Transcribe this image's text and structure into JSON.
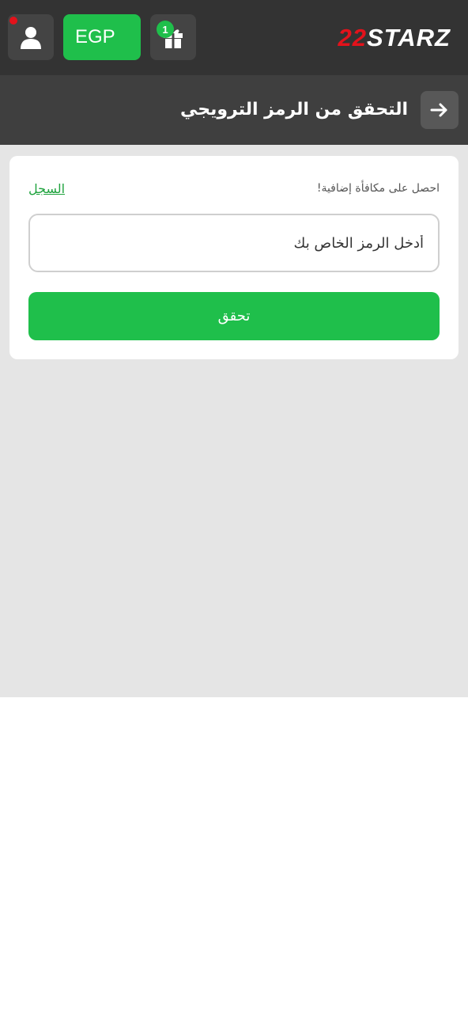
{
  "header": {
    "currency": "EGP",
    "gift_badge_count": "1",
    "logo_number": "22",
    "logo_word": "STARZ",
    "icons": {
      "user": "user-icon",
      "gift": "gift-icon",
      "back": "arrow-right-icon"
    },
    "colors": {
      "topbar": "#333333",
      "accent_green": "#1fbf4b",
      "notification_dot": "#e3121b",
      "logo_red": "#e3121b"
    }
  },
  "page": {
    "title": "التحقق من الرمز الترويجي"
  },
  "promo_card": {
    "bonus_text": "احصل على مكافأة إضافية!",
    "register_link": "السجل",
    "input_placeholder": "أدخل الرمز الخاص بك",
    "input_value": "",
    "verify_button": "تحقق"
  }
}
